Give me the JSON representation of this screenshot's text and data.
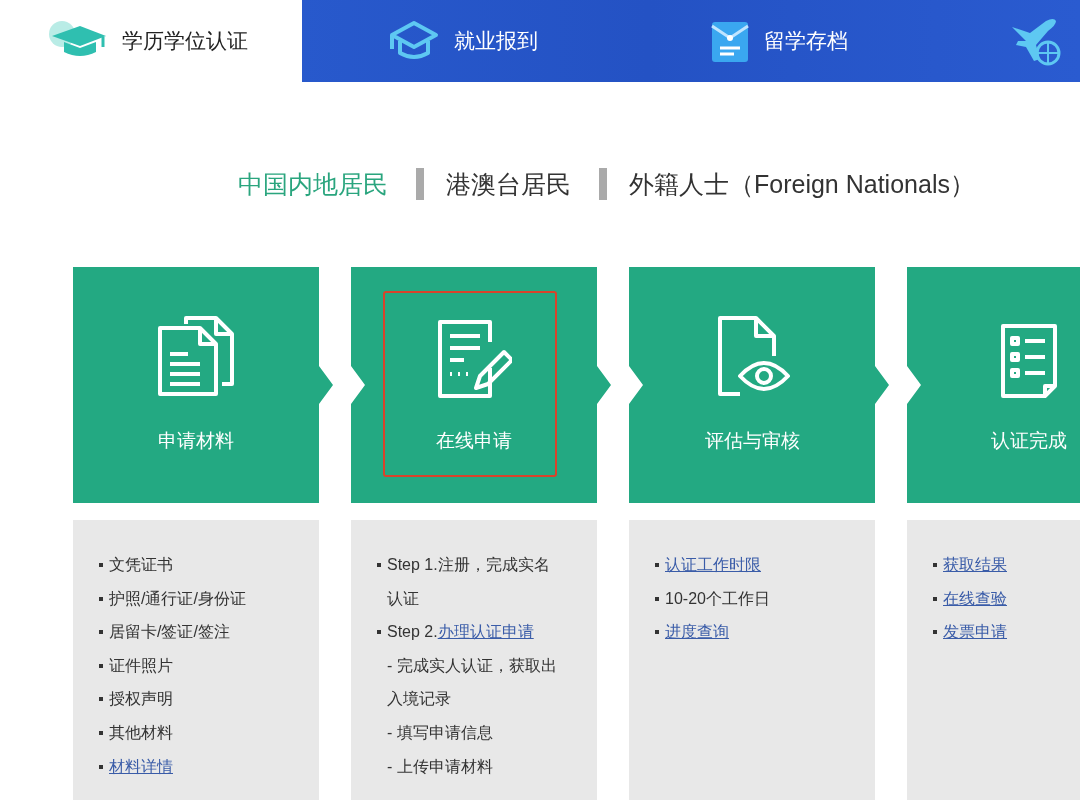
{
  "nav_tabs": [
    {
      "label": "学历学位认证",
      "selected": true
    },
    {
      "label": "就业报到",
      "selected": false
    },
    {
      "label": "留学存档",
      "selected": false
    },
    {
      "selected": false
    }
  ],
  "residency_tabs": [
    {
      "label": "中国内地居民",
      "selected": true
    },
    {
      "label": "港澳台居民",
      "selected": false
    },
    {
      "label": "外籍人士（Foreign Nationals）",
      "selected": false
    }
  ],
  "steps": [
    {
      "title": "申请材料",
      "highlighted": false,
      "details": [
        {
          "kind": "bullet",
          "text": "文凭证书"
        },
        {
          "kind": "bullet",
          "text": "护照/通行证/身份证"
        },
        {
          "kind": "bullet",
          "text": "居留卡/签证/签注"
        },
        {
          "kind": "bullet",
          "text": "证件照片"
        },
        {
          "kind": "bullet",
          "text": "授权声明"
        },
        {
          "kind": "bullet",
          "text": "其他材料"
        },
        {
          "kind": "bullet",
          "link": "材料详情"
        }
      ]
    },
    {
      "title": "在线申请",
      "highlighted": true,
      "details": [
        {
          "kind": "bullet",
          "text": "Step 1.注册，完成实名认证"
        },
        {
          "kind": "bullet",
          "text": "Step 2.",
          "link": "办理认证申请"
        },
        {
          "kind": "sub",
          "text": "- 完成实人认证，获取出入境记录"
        },
        {
          "kind": "sub",
          "text": "- 填写申请信息"
        },
        {
          "kind": "sub",
          "text": "- 上传申请材料"
        }
      ]
    },
    {
      "title": "评估与审核",
      "highlighted": false,
      "details": [
        {
          "kind": "bullet",
          "link": "认证工作时限"
        },
        {
          "kind": "bullet",
          "text": "10-20个工作日"
        },
        {
          "kind": "bullet",
          "link": "进度查询"
        }
      ]
    },
    {
      "title": "认证完成",
      "highlighted": false,
      "details": [
        {
          "kind": "bullet",
          "link": "获取结果"
        },
        {
          "kind": "bullet",
          "link": "在线查验"
        },
        {
          "kind": "bullet",
          "link": "发票申请"
        }
      ]
    }
  ]
}
